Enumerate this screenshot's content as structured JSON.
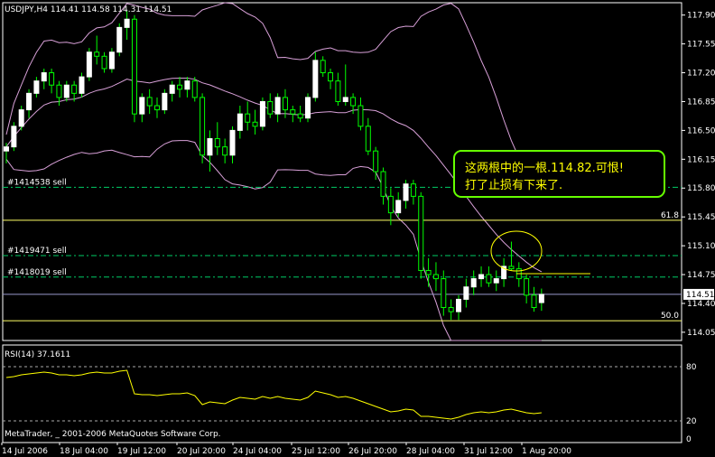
{
  "header": {
    "title": "USDJPY,H4  114.41 114.58 114.31 114.51"
  },
  "footer": {
    "copyright": "MetaTrader, _ 2001-2006 MetaQuotes Software Corp."
  },
  "colors": {
    "background": "#000000",
    "frame": "#ffffff",
    "bull": "#ffffff",
    "bear": "#00ff00",
    "bands": "#d8a0d8",
    "rsi": "#ffff00",
    "order": "#00cc66",
    "fib": "#ffff66",
    "annotation": "#66ff00"
  },
  "orders": [
    {
      "label": "#1414538 sell",
      "price": 115.81
    },
    {
      "label": "#1419471 sell",
      "price": 114.98
    },
    {
      "label": "#1418019 sell",
      "price": 114.72
    }
  ],
  "fib_levels": [
    {
      "label": "61.8",
      "price": 115.41
    },
    {
      "label": "50.0",
      "price": 114.19
    }
  ],
  "current_price": {
    "label": "114.51",
    "value": 114.51
  },
  "annotation": {
    "line1": "这两根中的一根.114.82.可恨!",
    "line2": "打了止损有下来了."
  },
  "chart_data": {
    "type": "candlestick",
    "symbol": "USDJPY",
    "timeframe": "H4",
    "ohlc_last": {
      "open": 114.41,
      "high": 114.58,
      "low": 114.31,
      "close": 114.51
    },
    "ylim": [
      113.95,
      118.05
    ],
    "y_ticks": [
      "117.90",
      "117.55",
      "117.20",
      "116.85",
      "116.50",
      "116.15",
      "115.80",
      "115.45",
      "115.10",
      "114.75",
      "114.40",
      "114.05"
    ],
    "x_ticks": [
      "14 Jul 2006",
      "18 Jul 04:00",
      "19 Jul 12:00",
      "20 Jul 20:00",
      "24 Jul 04:00",
      "25 Jul 12:00",
      "26 Jul 20:00",
      "28 Jul 04:00",
      "31 Jul 12:00",
      "1 Aug 20:00"
    ],
    "candles": [
      [
        116.25,
        116.35,
        116.1,
        116.3
      ],
      [
        116.3,
        116.6,
        116.25,
        116.55
      ],
      [
        116.55,
        116.8,
        116.5,
        116.75
      ],
      [
        116.75,
        117.0,
        116.65,
        116.95
      ],
      [
        116.95,
        117.15,
        116.9,
        117.1
      ],
      [
        117.1,
        117.25,
        117.0,
        117.2
      ],
      [
        117.2,
        117.25,
        116.95,
        117.05
      ],
      [
        117.05,
        117.1,
        116.8,
        116.9
      ],
      [
        116.9,
        117.1,
        116.85,
        117.05
      ],
      [
        117.05,
        117.1,
        116.85,
        116.95
      ],
      [
        116.95,
        117.2,
        116.9,
        117.15
      ],
      [
        117.15,
        117.5,
        117.1,
        117.45
      ],
      [
        117.45,
        117.65,
        117.3,
        117.4
      ],
      [
        117.4,
        117.45,
        117.2,
        117.25
      ],
      [
        117.25,
        117.5,
        117.2,
        117.45
      ],
      [
        117.45,
        117.8,
        117.4,
        117.75
      ],
      [
        117.75,
        117.95,
        117.6,
        117.85
      ],
      [
        117.85,
        117.9,
        116.6,
        116.7
      ],
      [
        116.7,
        116.95,
        116.6,
        116.9
      ],
      [
        116.9,
        117.0,
        116.7,
        116.8
      ],
      [
        116.8,
        116.9,
        116.65,
        116.75
      ],
      [
        116.75,
        117.0,
        116.7,
        116.95
      ],
      [
        116.95,
        117.1,
        116.85,
        117.05
      ],
      [
        117.05,
        117.15,
        116.9,
        117.0
      ],
      [
        117.0,
        117.15,
        116.9,
        117.1
      ],
      [
        117.1,
        117.15,
        116.85,
        116.9
      ],
      [
        116.9,
        116.95,
        116.1,
        116.2
      ],
      [
        116.2,
        116.5,
        116.0,
        116.4
      ],
      [
        116.4,
        116.6,
        116.2,
        116.3
      ],
      [
        116.3,
        116.4,
        116.1,
        116.2
      ],
      [
        116.2,
        116.55,
        116.1,
        116.5
      ],
      [
        116.5,
        116.8,
        116.4,
        116.7
      ],
      [
        116.7,
        116.85,
        116.5,
        116.6
      ],
      [
        116.6,
        116.75,
        116.45,
        116.55
      ],
      [
        116.55,
        116.9,
        116.5,
        116.85
      ],
      [
        116.85,
        116.95,
        116.65,
        116.7
      ],
      [
        116.7,
        116.95,
        116.6,
        116.9
      ],
      [
        116.9,
        117.0,
        116.65,
        116.75
      ],
      [
        116.75,
        116.8,
        116.6,
        116.7
      ],
      [
        116.7,
        116.8,
        116.6,
        116.65
      ],
      [
        116.65,
        116.95,
        116.6,
        116.9
      ],
      [
        116.9,
        117.45,
        116.85,
        117.35
      ],
      [
        117.35,
        117.4,
        117.15,
        117.2
      ],
      [
        117.2,
        117.25,
        117.0,
        117.1
      ],
      [
        117.1,
        117.2,
        116.8,
        116.85
      ],
      [
        116.85,
        117.3,
        116.8,
        116.9
      ],
      [
        116.9,
        116.95,
        116.7,
        116.8
      ],
      [
        116.8,
        116.9,
        116.5,
        116.55
      ],
      [
        116.55,
        116.65,
        116.2,
        116.25
      ],
      [
        116.25,
        116.3,
        115.9,
        116.0
      ],
      [
        116.0,
        116.05,
        115.6,
        115.7
      ],
      [
        115.7,
        115.8,
        115.35,
        115.5
      ],
      [
        115.5,
        115.75,
        115.45,
        115.65
      ],
      [
        115.65,
        115.9,
        115.55,
        115.85
      ],
      [
        115.85,
        115.9,
        115.6,
        115.7
      ],
      [
        115.7,
        115.75,
        114.7,
        114.8
      ],
      [
        114.8,
        114.95,
        114.6,
        114.75
      ],
      [
        114.75,
        114.9,
        114.55,
        114.7
      ],
      [
        114.7,
        114.8,
        114.25,
        114.35
      ],
      [
        114.35,
        114.45,
        114.2,
        114.3
      ],
      [
        114.3,
        114.5,
        114.2,
        114.45
      ],
      [
        114.45,
        114.7,
        114.35,
        114.6
      ],
      [
        114.6,
        114.8,
        114.5,
        114.7
      ],
      [
        114.7,
        114.85,
        114.6,
        114.75
      ],
      [
        114.75,
        114.85,
        114.6,
        114.65
      ],
      [
        114.65,
        114.8,
        114.55,
        114.7
      ],
      [
        114.7,
        114.95,
        114.6,
        114.85
      ],
      [
        114.85,
        115.15,
        114.8,
        114.82
      ],
      [
        114.82,
        114.9,
        114.6,
        114.7
      ],
      [
        114.7,
        114.75,
        114.4,
        114.5
      ],
      [
        114.5,
        114.6,
        114.3,
        114.35
      ],
      [
        114.41,
        114.58,
        114.31,
        114.51
      ]
    ],
    "indicator": {
      "name": "RSI(14) 37.1611",
      "period": 14,
      "ylim": [
        0,
        100
      ],
      "levels": [
        80,
        20
      ],
      "tick_labels": [
        "80",
        "20",
        "0"
      ],
      "values": [
        68,
        69,
        71,
        72,
        73,
        74,
        73,
        71,
        71,
        70,
        71,
        73,
        74,
        73,
        73,
        75,
        76,
        50,
        49,
        49,
        48,
        49,
        50,
        50,
        51,
        48,
        38,
        41,
        40,
        39,
        43,
        46,
        45,
        44,
        47,
        45,
        47,
        45,
        44,
        43,
        46,
        53,
        51,
        49,
        46,
        47,
        45,
        42,
        39,
        36,
        33,
        30,
        31,
        33,
        32,
        25,
        25,
        24,
        23,
        22,
        24,
        27,
        29,
        30,
        29,
        30,
        32,
        33,
        31,
        29,
        28,
        29
      ]
    }
  }
}
